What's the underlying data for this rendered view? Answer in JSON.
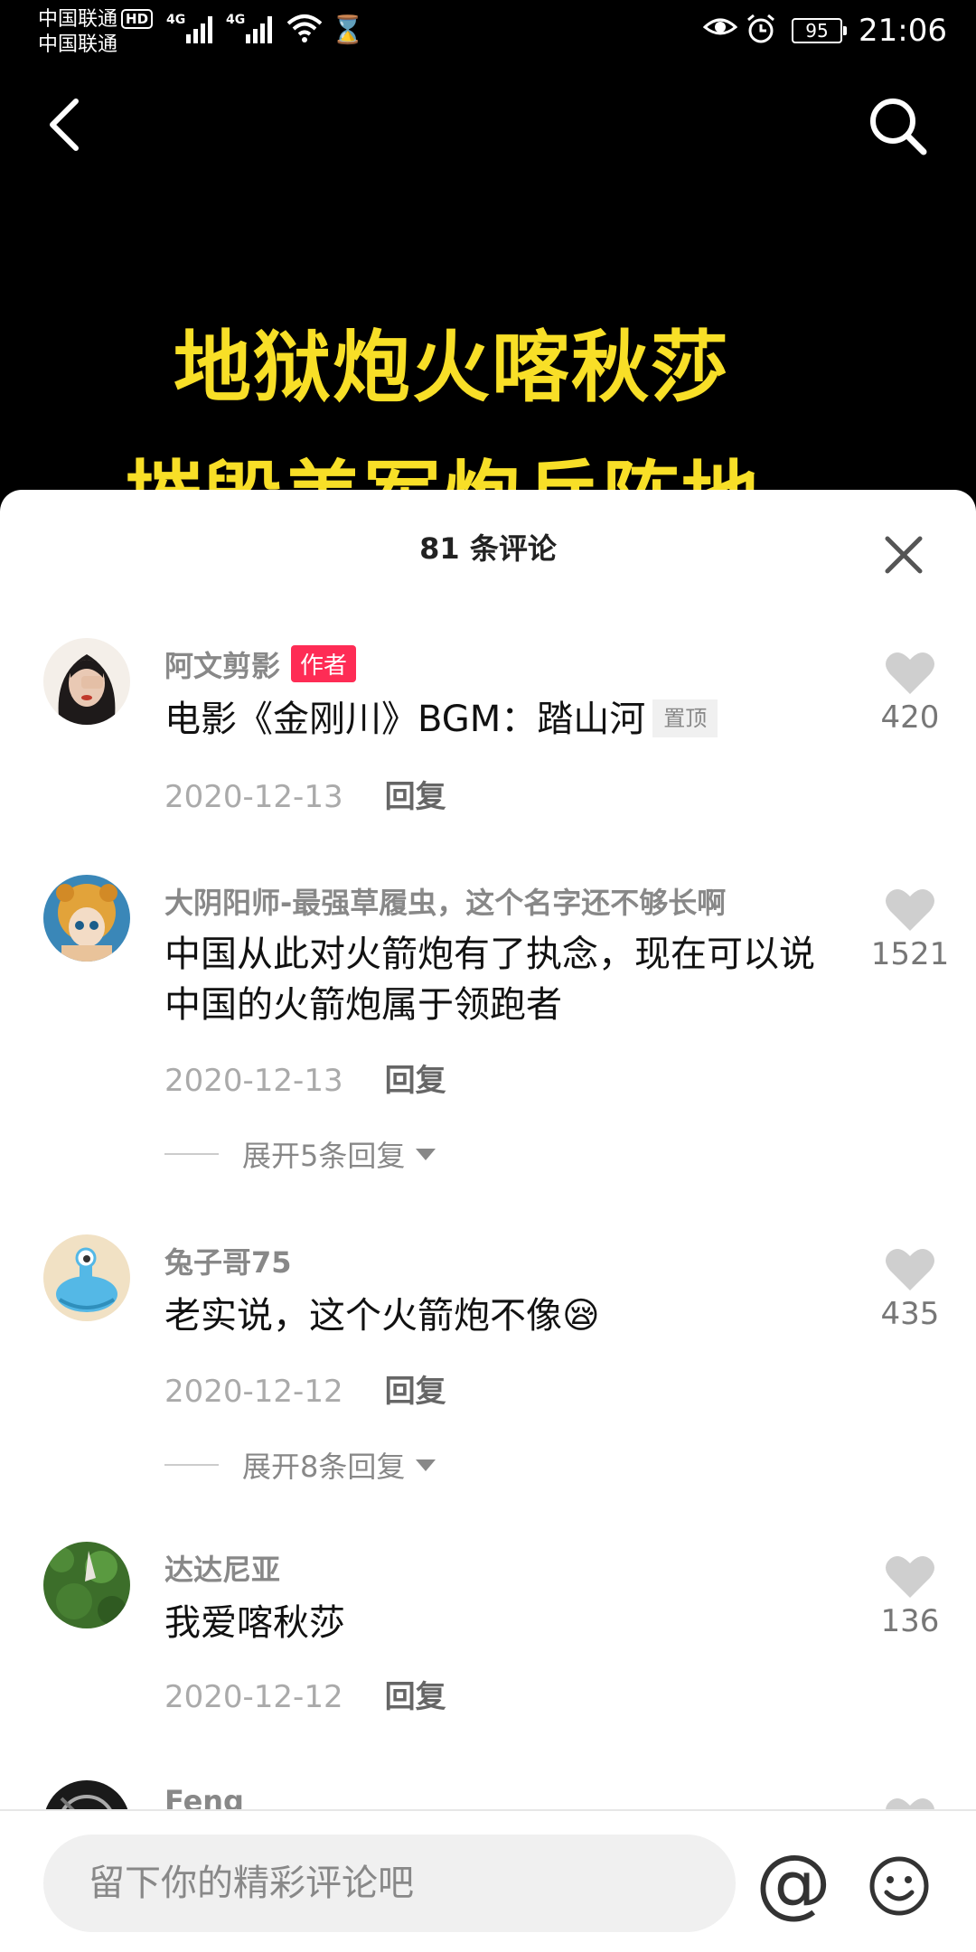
{
  "status_bar": {
    "carrier1": "中国联通",
    "carrier2": "中国联通",
    "hd": "HD",
    "net1": "4G",
    "net2": "4G",
    "battery": "95",
    "time": "21:06"
  },
  "video": {
    "title_line1": "地狱炮火喀秋莎",
    "title_line2": "摧毁美军炮兵阵地"
  },
  "comments_panel": {
    "title": "81 条评论"
  },
  "comments": [
    {
      "user": "阿文剪影",
      "tag": "作者",
      "text": "电影《金刚川》BGM：踏山河",
      "pin": "置顶",
      "date": "2020-12-13",
      "reply": "回复",
      "likes": "420"
    },
    {
      "user": "大阴阳师-最强草履虫，这个名字还不够长啊",
      "text": "中国从此对火箭炮有了执念，现在可以说中国的火箭炮属于领跑者",
      "date": "2020-12-13",
      "reply": "回复",
      "likes": "1521",
      "expand": "展开5条回复"
    },
    {
      "user": "兔子哥75",
      "text": "老实说，这个火箭炮不像😪",
      "date": "2020-12-12",
      "reply": "回复",
      "likes": "435",
      "expand": "展开8条回复"
    },
    {
      "user": "达达尼亚",
      "text": "我爱喀秋莎",
      "date": "2020-12-12",
      "reply": "回复",
      "likes": "136"
    },
    {
      "user": "Feng"
    }
  ],
  "input": {
    "placeholder": "留下你的精彩评论吧",
    "at_symbol": "@"
  },
  "colors": {
    "author_tag": "#fe2c55",
    "title_yellow": "#f8df27"
  }
}
